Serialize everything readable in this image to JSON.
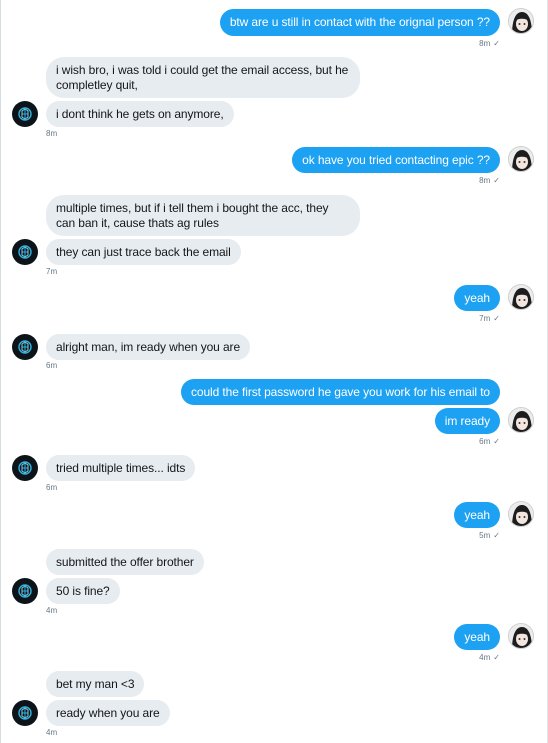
{
  "colors": {
    "outgoing": "#1da1f2",
    "incoming": "#e6ecf0",
    "meta_text": "#657786"
  },
  "icons": {
    "their_avatar": "blue-emblem-avatar-icon",
    "my_avatar": "anime-character-avatar-icon",
    "read_receipt": "check-icon"
  },
  "messages": [
    {
      "from": "me",
      "text": "btw are u still in contact with the orignal person ??"
    },
    {
      "from": "them",
      "text": "i wish bro, i was told i could get the email access, but he completley quit,"
    },
    {
      "from": "them",
      "text": "i dont think he gets on anymore,"
    },
    {
      "from": "me",
      "text": "ok have you tried contacting epic ??"
    },
    {
      "from": "them",
      "text": "multiple times, but if i tell them i bought the acc, they can ban it, cause thats ag rules"
    },
    {
      "from": "them",
      "text": "they can just trace back the email"
    },
    {
      "from": "me",
      "text": "yeah"
    },
    {
      "from": "them",
      "text": "alright man, im ready when you are"
    },
    {
      "from": "me",
      "text": "could the first password he gave you work for his email to"
    },
    {
      "from": "me",
      "text": "im ready"
    },
    {
      "from": "them",
      "text": "tried multiple times... idts"
    },
    {
      "from": "me",
      "text": "yeah"
    },
    {
      "from": "them",
      "text": "submitted the offer brother"
    },
    {
      "from": "them",
      "text": "50 is fine?"
    },
    {
      "from": "me",
      "text": "yeah"
    },
    {
      "from": "them",
      "text": "bet my man <3"
    },
    {
      "from": "them",
      "text": "ready when you are"
    }
  ],
  "timestamps": [
    "8m",
    "8m",
    "8m",
    "7m",
    "7m",
    "6m",
    "6m",
    "6m",
    "5m",
    "4m",
    "4m",
    "4m"
  ],
  "read_mark": "✓"
}
